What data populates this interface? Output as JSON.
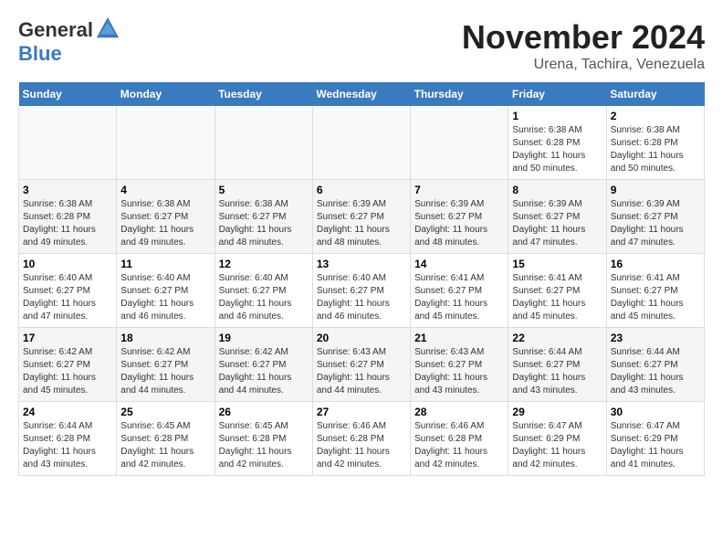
{
  "logo": {
    "general": "General",
    "blue": "Blue"
  },
  "title": "November 2024",
  "subtitle": "Urena, Tachira, Venezuela",
  "days_of_week": [
    "Sunday",
    "Monday",
    "Tuesday",
    "Wednesday",
    "Thursday",
    "Friday",
    "Saturday"
  ],
  "weeks": [
    [
      {
        "day": "",
        "info": ""
      },
      {
        "day": "",
        "info": ""
      },
      {
        "day": "",
        "info": ""
      },
      {
        "day": "",
        "info": ""
      },
      {
        "day": "",
        "info": ""
      },
      {
        "day": "1",
        "info": "Sunrise: 6:38 AM\nSunset: 6:28 PM\nDaylight: 11 hours and 50 minutes."
      },
      {
        "day": "2",
        "info": "Sunrise: 6:38 AM\nSunset: 6:28 PM\nDaylight: 11 hours and 50 minutes."
      }
    ],
    [
      {
        "day": "3",
        "info": "Sunrise: 6:38 AM\nSunset: 6:28 PM\nDaylight: 11 hours and 49 minutes."
      },
      {
        "day": "4",
        "info": "Sunrise: 6:38 AM\nSunset: 6:27 PM\nDaylight: 11 hours and 49 minutes."
      },
      {
        "day": "5",
        "info": "Sunrise: 6:38 AM\nSunset: 6:27 PM\nDaylight: 11 hours and 48 minutes."
      },
      {
        "day": "6",
        "info": "Sunrise: 6:39 AM\nSunset: 6:27 PM\nDaylight: 11 hours and 48 minutes."
      },
      {
        "day": "7",
        "info": "Sunrise: 6:39 AM\nSunset: 6:27 PM\nDaylight: 11 hours and 48 minutes."
      },
      {
        "day": "8",
        "info": "Sunrise: 6:39 AM\nSunset: 6:27 PM\nDaylight: 11 hours and 47 minutes."
      },
      {
        "day": "9",
        "info": "Sunrise: 6:39 AM\nSunset: 6:27 PM\nDaylight: 11 hours and 47 minutes."
      }
    ],
    [
      {
        "day": "10",
        "info": "Sunrise: 6:40 AM\nSunset: 6:27 PM\nDaylight: 11 hours and 47 minutes."
      },
      {
        "day": "11",
        "info": "Sunrise: 6:40 AM\nSunset: 6:27 PM\nDaylight: 11 hours and 46 minutes."
      },
      {
        "day": "12",
        "info": "Sunrise: 6:40 AM\nSunset: 6:27 PM\nDaylight: 11 hours and 46 minutes."
      },
      {
        "day": "13",
        "info": "Sunrise: 6:40 AM\nSunset: 6:27 PM\nDaylight: 11 hours and 46 minutes."
      },
      {
        "day": "14",
        "info": "Sunrise: 6:41 AM\nSunset: 6:27 PM\nDaylight: 11 hours and 45 minutes."
      },
      {
        "day": "15",
        "info": "Sunrise: 6:41 AM\nSunset: 6:27 PM\nDaylight: 11 hours and 45 minutes."
      },
      {
        "day": "16",
        "info": "Sunrise: 6:41 AM\nSunset: 6:27 PM\nDaylight: 11 hours and 45 minutes."
      }
    ],
    [
      {
        "day": "17",
        "info": "Sunrise: 6:42 AM\nSunset: 6:27 PM\nDaylight: 11 hours and 45 minutes."
      },
      {
        "day": "18",
        "info": "Sunrise: 6:42 AM\nSunset: 6:27 PM\nDaylight: 11 hours and 44 minutes."
      },
      {
        "day": "19",
        "info": "Sunrise: 6:42 AM\nSunset: 6:27 PM\nDaylight: 11 hours and 44 minutes."
      },
      {
        "day": "20",
        "info": "Sunrise: 6:43 AM\nSunset: 6:27 PM\nDaylight: 11 hours and 44 minutes."
      },
      {
        "day": "21",
        "info": "Sunrise: 6:43 AM\nSunset: 6:27 PM\nDaylight: 11 hours and 43 minutes."
      },
      {
        "day": "22",
        "info": "Sunrise: 6:44 AM\nSunset: 6:27 PM\nDaylight: 11 hours and 43 minutes."
      },
      {
        "day": "23",
        "info": "Sunrise: 6:44 AM\nSunset: 6:27 PM\nDaylight: 11 hours and 43 minutes."
      }
    ],
    [
      {
        "day": "24",
        "info": "Sunrise: 6:44 AM\nSunset: 6:28 PM\nDaylight: 11 hours and 43 minutes."
      },
      {
        "day": "25",
        "info": "Sunrise: 6:45 AM\nSunset: 6:28 PM\nDaylight: 11 hours and 42 minutes."
      },
      {
        "day": "26",
        "info": "Sunrise: 6:45 AM\nSunset: 6:28 PM\nDaylight: 11 hours and 42 minutes."
      },
      {
        "day": "27",
        "info": "Sunrise: 6:46 AM\nSunset: 6:28 PM\nDaylight: 11 hours and 42 minutes."
      },
      {
        "day": "28",
        "info": "Sunrise: 6:46 AM\nSunset: 6:28 PM\nDaylight: 11 hours and 42 minutes."
      },
      {
        "day": "29",
        "info": "Sunrise: 6:47 AM\nSunset: 6:29 PM\nDaylight: 11 hours and 42 minutes."
      },
      {
        "day": "30",
        "info": "Sunrise: 6:47 AM\nSunset: 6:29 PM\nDaylight: 11 hours and 41 minutes."
      }
    ]
  ]
}
